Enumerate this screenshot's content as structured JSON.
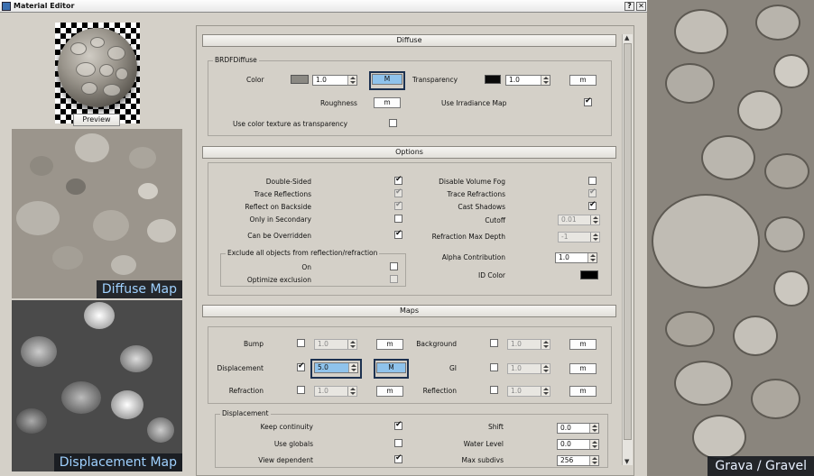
{
  "window": {
    "title": "Material Editor",
    "help_label": "?",
    "close_label": "✕"
  },
  "preview": {
    "button_label": "Preview"
  },
  "images": {
    "diffuse_label": "Diffuse Map",
    "displacement_label": "Displacement Map",
    "gravel_label": "Grava / Gravel"
  },
  "diffuse": {
    "header": "Diffuse",
    "group_title": "BRDFDiffuse",
    "color_label": "Color",
    "color_swatch": "#8b8983",
    "color_value": "1.0",
    "color_map": "M",
    "transparency_label": "Transparency",
    "transparency_swatch": "#0a0a0a",
    "transparency_value": "1.0",
    "transparency_map": "m",
    "roughness_label": "Roughness",
    "roughness_map": "m",
    "irradiance_label": "Use Irradiance Map",
    "color_texture_label": "Use color texture as transparency"
  },
  "options": {
    "header": "Options",
    "double_sided": "Double-Sided",
    "trace_reflections": "Trace Reflections",
    "reflect_backside": "Reflect on Backside",
    "only_secondary": "Only in Secondary",
    "can_be_overridden": "Can be Overridden",
    "disable_volume_fog": "Disable Volume Fog",
    "trace_refractions": "Trace Refractions",
    "cast_shadows": "Cast Shadows",
    "cutoff": "Cutoff",
    "cutoff_value": "0.01",
    "refraction_max_depth": "Refraction Max Depth",
    "refraction_max_depth_value": "-1",
    "alpha_contribution": "Alpha Contribution",
    "alpha_contribution_value": "1.0",
    "id_color": "ID Color",
    "id_color_swatch": "#000000",
    "exclude_group": "Exclude all objects from reflection/refraction",
    "on": "On",
    "optimize_exclusion": "Optimize exclusion"
  },
  "maps": {
    "header": "Maps",
    "bump": "Bump",
    "bump_value": "1.0",
    "bump_map": "m",
    "background": "Background",
    "background_value": "1.0",
    "background_map": "m",
    "displacement": "Displacement",
    "displacement_value": "5.0",
    "displacement_map": "M",
    "gi": "GI",
    "gi_value": "1.0",
    "gi_map": "m",
    "refraction": "Refraction",
    "refraction_value": "1.0",
    "refraction_map": "m",
    "reflection": "Reflection",
    "reflection_value": "1.0",
    "reflection_map": "m"
  },
  "displacement": {
    "group_title": "Displacement",
    "keep_continuity": "Keep continuity",
    "use_globals": "Use globals",
    "view_dependent": "View dependent",
    "shift": "Shift",
    "shift_value": "0.0",
    "water_level": "Water Level",
    "water_level_value": "0.0",
    "max_subdivs": "Max subdivs",
    "max_subdivs_value": "256"
  }
}
